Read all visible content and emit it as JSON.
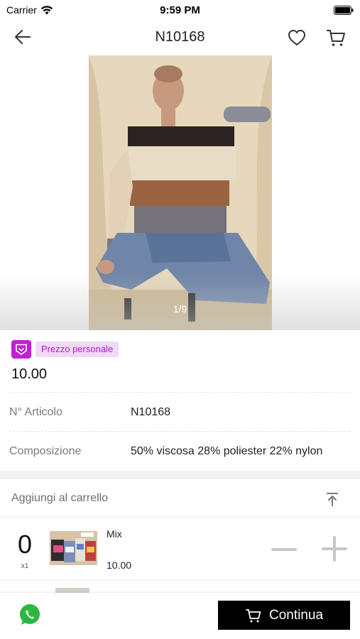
{
  "status_bar": {
    "carrier": "Carrier",
    "time": "9:59 PM"
  },
  "nav": {
    "title": "N10168"
  },
  "gallery": {
    "counter": "1/9"
  },
  "pricing": {
    "badge_label": "Prezzo personale",
    "price": "10.00"
  },
  "details": [
    {
      "label": "N° Articolo",
      "value": "N10168"
    },
    {
      "label": "Composizione",
      "value": "50% viscosa 28% poliester 22% nylon"
    }
  ],
  "cart_section": {
    "title": "Aggiungi al carrello",
    "items": [
      {
        "quantity": "0",
        "multiplier": "x1",
        "name": "Mix",
        "price": "10.00"
      }
    ]
  },
  "bottom_bar": {
    "continue_label": "Continua"
  },
  "colors": {
    "accent": "#c21fd6",
    "badge_bg": "#f1d8f7",
    "cta_bg": "#000000"
  }
}
